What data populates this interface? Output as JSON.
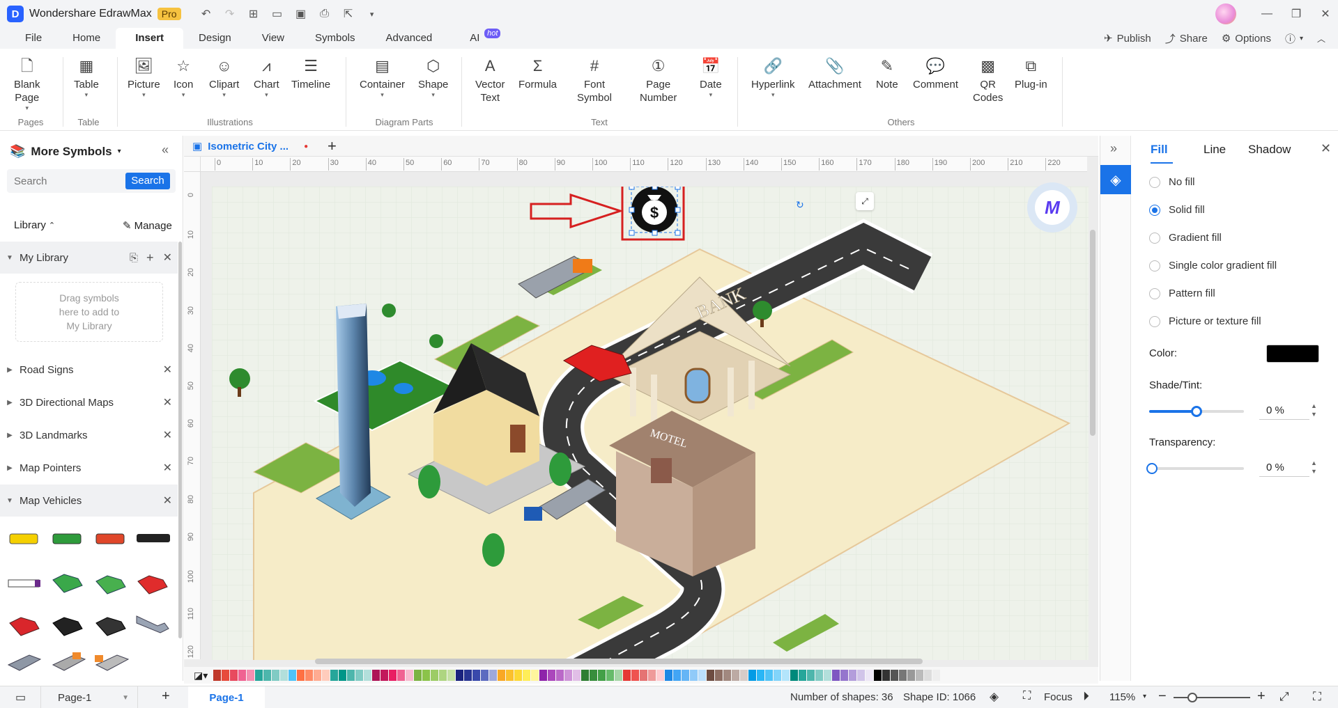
{
  "app": {
    "title": "Wondershare EdrawMax",
    "badge": "Pro"
  },
  "menu": {
    "items": [
      "File",
      "Home",
      "Insert",
      "Design",
      "View",
      "Symbols",
      "Advanced",
      "AI"
    ],
    "active": "Insert",
    "ai_badge": "hot"
  },
  "topright": {
    "publish": "Publish",
    "share": "Share",
    "options": "Options"
  },
  "ribbon": {
    "buttons": {
      "blank_page": "Blank\nPage",
      "table": "Table",
      "picture": "Picture",
      "icon": "Icon",
      "clipart": "Clipart",
      "chart": "Chart",
      "timeline": "Timeline",
      "container": "Container",
      "shape": "Shape",
      "vector_text": "Vector\nText",
      "formula": "Formula",
      "font_symbol": "Font\nSymbol",
      "page_number": "Page\nNumber",
      "date": "Date",
      "hyperlink": "Hyperlink",
      "attachment": "Attachment",
      "note": "Note",
      "comment": "Comment",
      "qr_codes": "QR\nCodes",
      "plugin": "Plug-in"
    },
    "groups": {
      "pages": "Pages",
      "table": "Table",
      "illustrations": "Illustrations",
      "diagram_parts": "Diagram Parts",
      "text": "Text",
      "others": "Others"
    }
  },
  "left": {
    "title": "More Symbols",
    "search_placeholder": "Search",
    "search_button": "Search",
    "library_label": "Library",
    "manage_label": "Manage",
    "my_library": "My Library",
    "drag_hint": "Drag symbols\nhere to add to\nMy Library",
    "libraries": [
      "Road Signs",
      "3D Directional Maps",
      "3D Landmarks",
      "Map Pointers",
      "Map Vehicles"
    ]
  },
  "doc_tab": {
    "name": "Isometric City ..."
  },
  "ruler_h": [
    "0",
    "10",
    "20",
    "30",
    "40",
    "50",
    "60",
    "70",
    "80",
    "90",
    "100",
    "110",
    "120",
    "130",
    "140",
    "150",
    "160",
    "170",
    "180",
    "190",
    "200",
    "210",
    "220"
  ],
  "ruler_v": [
    "0",
    "10",
    "20",
    "30",
    "40",
    "50",
    "60",
    "70",
    "80",
    "90",
    "100",
    "110",
    "120"
  ],
  "canvas": {
    "bank_label": "BANK",
    "motel_label": "MOTEL",
    "money_symbol": "$"
  },
  "right": {
    "tabs": [
      "Fill",
      "Line",
      "Shadow"
    ],
    "active_tab": "Fill",
    "fill_options": [
      "No fill",
      "Solid fill",
      "Gradient fill",
      "Single color gradient fill",
      "Pattern fill",
      "Picture or texture fill"
    ],
    "selected_fill": "Solid fill",
    "color_label": "Color:",
    "color_value": "#000000",
    "shade_label": "Shade/Tint:",
    "shade_value": "0 %",
    "shade_level": 0.5,
    "transparency_label": "Transparency:",
    "transparency_value": "0 %",
    "transparency_level": 0
  },
  "status": {
    "page_selector": "Page-1",
    "page_tab": "Page-1",
    "shapes": "Number of shapes: 36",
    "shape_id": "Shape ID: 1066",
    "focus": "Focus",
    "zoom": "115%"
  },
  "palette_colors": [
    "#c0392b",
    "#e74c3c",
    "#e84a5f",
    "#f06292",
    "#f48fb1",
    "#26a69a",
    "#4db6ac",
    "#80cbc4",
    "#b2dfdb",
    "#4fc3f7",
    "#ff7043",
    "#ff8a65",
    "#ffab91",
    "#ffccbc",
    "#26a69a",
    "#009688",
    "#4db6ac",
    "#80cbc4",
    "#b2dfdb",
    "#ad1457",
    "#c2185b",
    "#e91e63",
    "#f06292",
    "#f8bbd0",
    "#7cb342",
    "#8bc34a",
    "#9ccc65",
    "#aed581",
    "#c5e1a5",
    "#1a237e",
    "#283593",
    "#3949ab",
    "#5c6bc0",
    "#9fa8da",
    "#f9a825",
    "#fbc02d",
    "#fdd835",
    "#ffee58",
    "#fff59d",
    "#8e24aa",
    "#ab47bc",
    "#ba68c8",
    "#ce93d8",
    "#e1bee7",
    "#2e7d32",
    "#388e3c",
    "#43a047",
    "#66bb6a",
    "#a5d6a7",
    "#e53935",
    "#ef5350",
    "#e57373",
    "#ef9a9a",
    "#ffcdd2",
    "#1e88e5",
    "#42a5f5",
    "#64b5f6",
    "#90caf9",
    "#bbdefb",
    "#6d4c41",
    "#8d6e63",
    "#a1887f",
    "#bcaaa4",
    "#d7ccc8",
    "#039be5",
    "#29b6f6",
    "#4fc3f7",
    "#81d4fa",
    "#b3e5fc",
    "#00897b",
    "#26a69a",
    "#4db6ac",
    "#80cbc4",
    "#b2dfdb",
    "#7e57c2",
    "#9575cd",
    "#b39ddb",
    "#d1c4e9",
    "#ede7f6",
    "#000000",
    "#333333",
    "#555555",
    "#777777",
    "#999999",
    "#bbbbbb",
    "#dddddd",
    "#eeeeee"
  ]
}
